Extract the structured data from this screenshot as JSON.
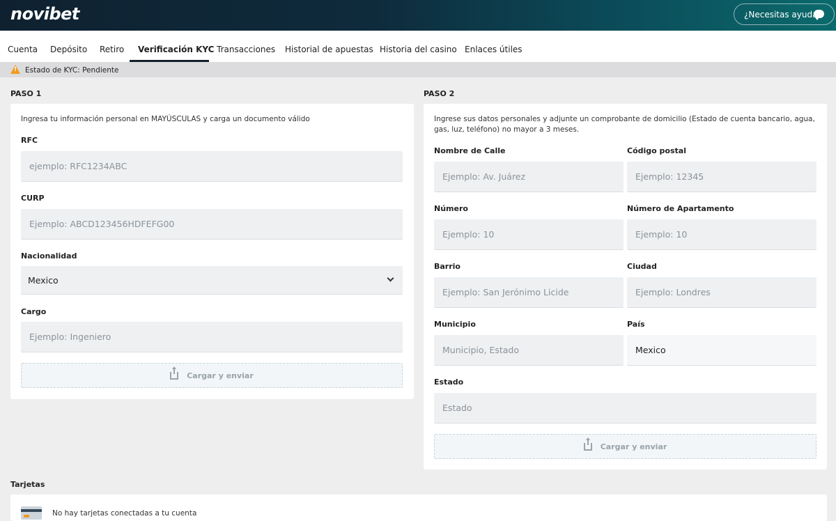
{
  "header": {
    "logo": "novibet",
    "help_label": "¿Necesitas ayuda?"
  },
  "nav": {
    "tabs": [
      {
        "label": "Cuenta"
      },
      {
        "label": "Depósito"
      },
      {
        "label": "Retiro"
      },
      {
        "label": "Verificación KYC",
        "active": true
      },
      {
        "label": "Transacciones"
      },
      {
        "label": "Historial de apuestas"
      },
      {
        "label": "Historia del casino"
      },
      {
        "label": "Enlaces útiles"
      }
    ]
  },
  "kyc_status": "Estado de KYC: Pendiente",
  "step1": {
    "title": "PASO 1",
    "description": "Ingresa tu información personal en MAYÚSCULAS y carga un documento válido",
    "rfc": {
      "label": "RFC",
      "placeholder": "ejemplo: RFC1234ABC"
    },
    "curp": {
      "label": "CURP",
      "placeholder": "Ejemplo: ABCD123456HDFEFG00"
    },
    "nacionalidad": {
      "label": "Nacionalidad",
      "value": "Mexico"
    },
    "cargo": {
      "label": "Cargo",
      "placeholder": "Ejemplo: Ingeniero"
    },
    "upload_label": "Cargar y enviar"
  },
  "step2": {
    "title": "PASO 2",
    "description": "Ingrese sus datos personales y adjunte un comprobante de domicilio (Estado de cuenta bancario, agua, gas, luz, teléfono) no mayor a 3 meses.",
    "calle": {
      "label": "Nombre de Calle",
      "placeholder": "Ejemplo: Av. Juárez"
    },
    "codigo_postal": {
      "label": "Código postal",
      "placeholder": "Ejemplo: 12345"
    },
    "numero": {
      "label": "Número",
      "placeholder": "Ejemplo: 10"
    },
    "apartamento": {
      "label": "Número de Apartamento",
      "placeholder": "Ejemplo: 10"
    },
    "barrio": {
      "label": "Barrio",
      "placeholder": "Ejemplo: San Jerónimo Licide"
    },
    "ciudad": {
      "label": "Ciudad",
      "placeholder": "Ejemplo: Londres"
    },
    "municipio": {
      "label": "Municipio",
      "placeholder": "Municipio, Estado"
    },
    "pais": {
      "label": "País",
      "value": "Mexico"
    },
    "estado": {
      "label": "Estado",
      "placeholder": "Estado"
    },
    "upload_label": "Cargar y enviar"
  },
  "cards": {
    "title": "Tarjetas",
    "empty_message": "No hay tarjetas conectadas a tu cuenta"
  }
}
